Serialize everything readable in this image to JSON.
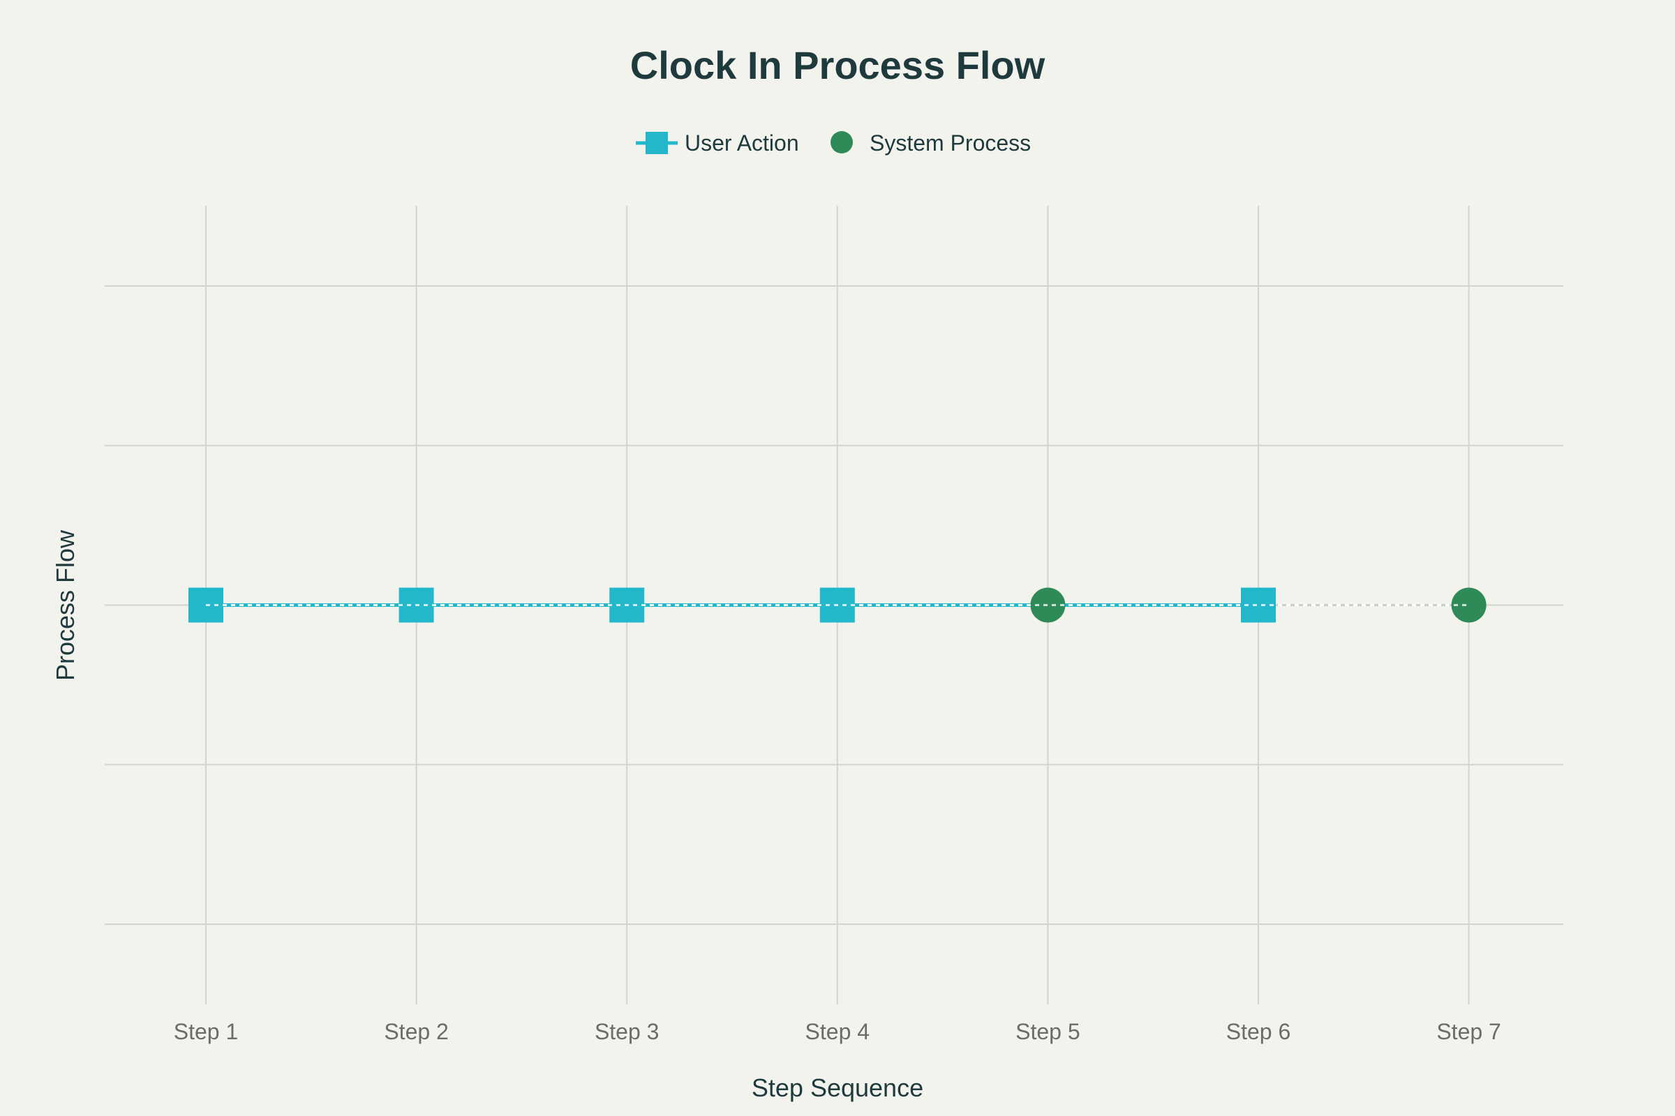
{
  "chart_data": {
    "type": "scatter",
    "title": "Clock In Process Flow",
    "xlabel": "Step Sequence",
    "ylabel": "Process Flow",
    "x": [
      "Step 1",
      "Step 2",
      "Step 3",
      "Step 4",
      "Step 5",
      "Step 6",
      "Step 7"
    ],
    "ylim": [
      -2,
      2
    ],
    "grid": true,
    "legend_position": "top-center",
    "series": [
      {
        "name": "User Action",
        "marker": "square",
        "color": "#23b7cb",
        "points": [
          {
            "x": "Step 1",
            "y": 0
          },
          {
            "x": "Step 2",
            "y": 0
          },
          {
            "x": "Step 3",
            "y": 0
          },
          {
            "x": "Step 4",
            "y": 0
          },
          {
            "x": "Step 6",
            "y": 0
          }
        ]
      },
      {
        "name": "System Process",
        "marker": "circle",
        "color": "#2e8b57",
        "points": [
          {
            "x": "Step 5",
            "y": 0
          },
          {
            "x": "Step 7",
            "y": 0
          }
        ]
      }
    ]
  },
  "colors": {
    "background": "#f3f3ee",
    "text": "#1f3a3d",
    "tick_text": "#6b6b6b",
    "grid": "#d3d3cf",
    "connector": "#23b7cb",
    "connector_faint": "#c8cfce"
  }
}
